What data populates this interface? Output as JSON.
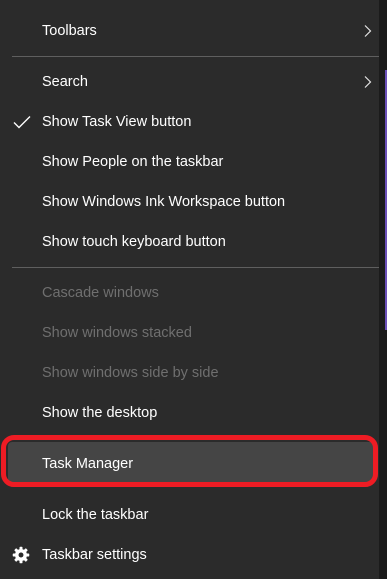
{
  "menu": {
    "items": [
      {
        "label": "Toolbars",
        "submenu": true
      },
      {
        "label": "Search",
        "submenu": true
      },
      {
        "label": "Show Task View button",
        "checked": true
      },
      {
        "label": "Show People on the taskbar"
      },
      {
        "label": "Show Windows Ink Workspace button"
      },
      {
        "label": "Show touch keyboard button"
      },
      {
        "label": "Cascade windows",
        "enabled": false
      },
      {
        "label": "Show windows stacked",
        "enabled": false
      },
      {
        "label": "Show windows side by side",
        "enabled": false
      },
      {
        "label": "Show the desktop"
      },
      {
        "label": "Task Manager",
        "highlighted": true
      },
      {
        "label": "Lock the taskbar"
      },
      {
        "label": "Taskbar settings",
        "icon": "gear-icon"
      }
    ]
  },
  "colors": {
    "menu_background": "#2b2b2b",
    "highlight_background": "#454545",
    "annotation_outline": "#ee1c24",
    "disabled_text": "#6f6f6f",
    "text": "#ffffff"
  },
  "icons": {
    "submenu": "chevron-right-icon",
    "checked": "checkmark-icon",
    "settings": "gear-icon"
  }
}
